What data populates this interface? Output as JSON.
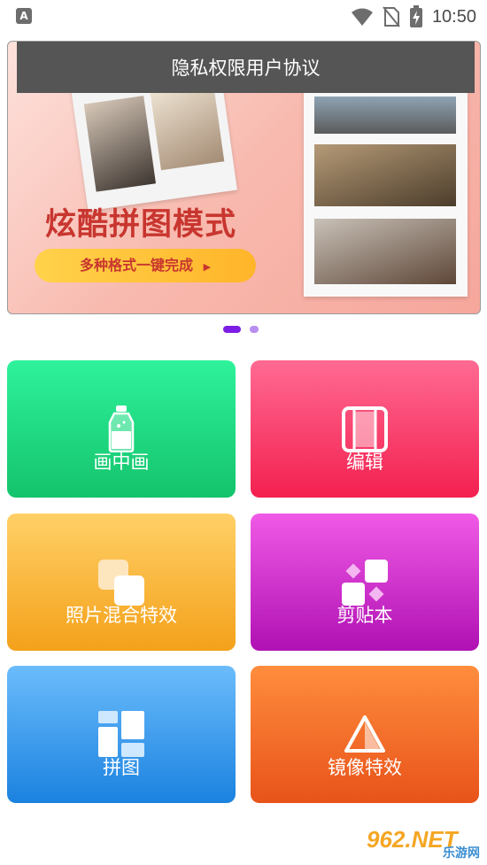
{
  "status_bar": {
    "left_icon": "A",
    "time": "10:50",
    "icons": [
      "wifi-icon",
      "no-sim-icon",
      "battery-charging-icon"
    ]
  },
  "banner": {
    "title_bar": "隐私权限用户协议",
    "headline": "炫酷拼图模式",
    "pill_text": "多种格式一键完成",
    "pill_arrow": "▶"
  },
  "pagination": {
    "count": 2,
    "active": 0
  },
  "tiles": [
    {
      "label": "画中画",
      "icon": "bottle-icon",
      "colors": [
        "#2ef29b",
        "#14c36c"
      ]
    },
    {
      "label": "编辑",
      "icon": "edit-frame-icon",
      "colors": [
        "#ff6a93",
        "#f3204f"
      ]
    },
    {
      "label": "照片混合特效",
      "icon": "blend-squares-icon",
      "colors": [
        "#ffd067",
        "#f4a11a"
      ]
    },
    {
      "label": "剪贴本",
      "icon": "scrapbook-icon",
      "colors": [
        "#f05ae6",
        "#b011b3"
      ]
    },
    {
      "label": "拼图",
      "icon": "collage-grid-icon",
      "colors": [
        "#6bbcfb",
        "#1b82e0"
      ]
    },
    {
      "label": "镜像特效",
      "icon": "mirror-triangle-icon",
      "colors": [
        "#ff8d3d",
        "#e8531a"
      ]
    }
  ],
  "watermark": {
    "main": "962.NET",
    "sub": "乐游网"
  }
}
